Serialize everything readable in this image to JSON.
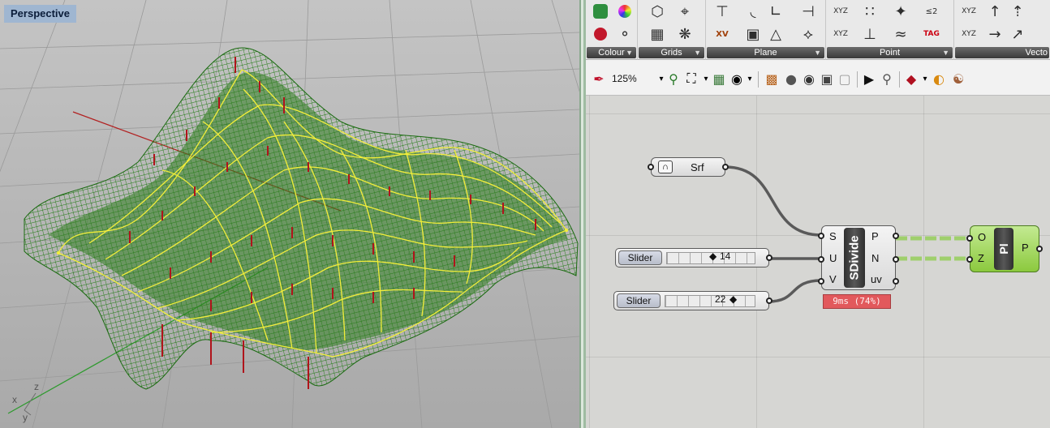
{
  "viewport": {
    "label": "Perspective",
    "axis_x": "x",
    "axis_y": "y",
    "axis_z": "z"
  },
  "ribbon": {
    "groups": [
      {
        "label": "Colour"
      },
      {
        "label": "Grids"
      },
      {
        "label": "Plane"
      },
      {
        "label": "Point"
      },
      {
        "label": "Vecto"
      }
    ],
    "text_icons": {
      "xyz": "XYZ",
      "xv": "XV",
      "tag": "TAG",
      "cmp": "≤2"
    }
  },
  "toolbar": {
    "zoom": "125%"
  },
  "canvas": {
    "srf": {
      "label": "Srf"
    },
    "slider_u": {
      "name": "Slider",
      "value": "14"
    },
    "slider_v": {
      "name": "Slider",
      "value": "22"
    },
    "sdivide": {
      "title": "SDivide",
      "inputs": [
        "S",
        "U",
        "V"
      ],
      "outputs": [
        "P",
        "N",
        "uv"
      ],
      "timing": "9ms (74%)"
    },
    "pl": {
      "title": "Pl",
      "inputs": [
        "O",
        "Z"
      ],
      "output": "P"
    }
  },
  "colors": {
    "viewport_bg": "#b6b6b6",
    "mesh_green": "#1f7a12",
    "surface_yellow": "#f2ee3a",
    "point_red": "#b0141b",
    "pl_green": "#8cc93e",
    "timing_red": "#e2595c"
  }
}
